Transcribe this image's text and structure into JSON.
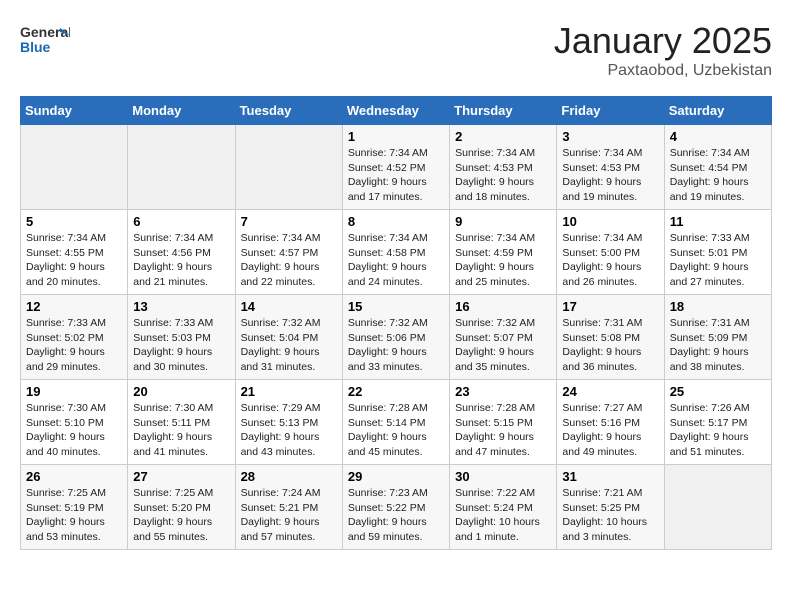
{
  "header": {
    "logo_line1": "General",
    "logo_line2": "Blue",
    "month": "January 2025",
    "location": "Paxtaobod, Uzbekistan"
  },
  "weekdays": [
    "Sunday",
    "Monday",
    "Tuesday",
    "Wednesday",
    "Thursday",
    "Friday",
    "Saturday"
  ],
  "weeks": [
    [
      {
        "day": "",
        "info": ""
      },
      {
        "day": "",
        "info": ""
      },
      {
        "day": "",
        "info": ""
      },
      {
        "day": "1",
        "info": "Sunrise: 7:34 AM\nSunset: 4:52 PM\nDaylight: 9 hours\nand 17 minutes."
      },
      {
        "day": "2",
        "info": "Sunrise: 7:34 AM\nSunset: 4:53 PM\nDaylight: 9 hours\nand 18 minutes."
      },
      {
        "day": "3",
        "info": "Sunrise: 7:34 AM\nSunset: 4:53 PM\nDaylight: 9 hours\nand 19 minutes."
      },
      {
        "day": "4",
        "info": "Sunrise: 7:34 AM\nSunset: 4:54 PM\nDaylight: 9 hours\nand 19 minutes."
      }
    ],
    [
      {
        "day": "5",
        "info": "Sunrise: 7:34 AM\nSunset: 4:55 PM\nDaylight: 9 hours\nand 20 minutes."
      },
      {
        "day": "6",
        "info": "Sunrise: 7:34 AM\nSunset: 4:56 PM\nDaylight: 9 hours\nand 21 minutes."
      },
      {
        "day": "7",
        "info": "Sunrise: 7:34 AM\nSunset: 4:57 PM\nDaylight: 9 hours\nand 22 minutes."
      },
      {
        "day": "8",
        "info": "Sunrise: 7:34 AM\nSunset: 4:58 PM\nDaylight: 9 hours\nand 24 minutes."
      },
      {
        "day": "9",
        "info": "Sunrise: 7:34 AM\nSunset: 4:59 PM\nDaylight: 9 hours\nand 25 minutes."
      },
      {
        "day": "10",
        "info": "Sunrise: 7:34 AM\nSunset: 5:00 PM\nDaylight: 9 hours\nand 26 minutes."
      },
      {
        "day": "11",
        "info": "Sunrise: 7:33 AM\nSunset: 5:01 PM\nDaylight: 9 hours\nand 27 minutes."
      }
    ],
    [
      {
        "day": "12",
        "info": "Sunrise: 7:33 AM\nSunset: 5:02 PM\nDaylight: 9 hours\nand 29 minutes."
      },
      {
        "day": "13",
        "info": "Sunrise: 7:33 AM\nSunset: 5:03 PM\nDaylight: 9 hours\nand 30 minutes."
      },
      {
        "day": "14",
        "info": "Sunrise: 7:32 AM\nSunset: 5:04 PM\nDaylight: 9 hours\nand 31 minutes."
      },
      {
        "day": "15",
        "info": "Sunrise: 7:32 AM\nSunset: 5:06 PM\nDaylight: 9 hours\nand 33 minutes."
      },
      {
        "day": "16",
        "info": "Sunrise: 7:32 AM\nSunset: 5:07 PM\nDaylight: 9 hours\nand 35 minutes."
      },
      {
        "day": "17",
        "info": "Sunrise: 7:31 AM\nSunset: 5:08 PM\nDaylight: 9 hours\nand 36 minutes."
      },
      {
        "day": "18",
        "info": "Sunrise: 7:31 AM\nSunset: 5:09 PM\nDaylight: 9 hours\nand 38 minutes."
      }
    ],
    [
      {
        "day": "19",
        "info": "Sunrise: 7:30 AM\nSunset: 5:10 PM\nDaylight: 9 hours\nand 40 minutes."
      },
      {
        "day": "20",
        "info": "Sunrise: 7:30 AM\nSunset: 5:11 PM\nDaylight: 9 hours\nand 41 minutes."
      },
      {
        "day": "21",
        "info": "Sunrise: 7:29 AM\nSunset: 5:13 PM\nDaylight: 9 hours\nand 43 minutes."
      },
      {
        "day": "22",
        "info": "Sunrise: 7:28 AM\nSunset: 5:14 PM\nDaylight: 9 hours\nand 45 minutes."
      },
      {
        "day": "23",
        "info": "Sunrise: 7:28 AM\nSunset: 5:15 PM\nDaylight: 9 hours\nand 47 minutes."
      },
      {
        "day": "24",
        "info": "Sunrise: 7:27 AM\nSunset: 5:16 PM\nDaylight: 9 hours\nand 49 minutes."
      },
      {
        "day": "25",
        "info": "Sunrise: 7:26 AM\nSunset: 5:17 PM\nDaylight: 9 hours\nand 51 minutes."
      }
    ],
    [
      {
        "day": "26",
        "info": "Sunrise: 7:25 AM\nSunset: 5:19 PM\nDaylight: 9 hours\nand 53 minutes."
      },
      {
        "day": "27",
        "info": "Sunrise: 7:25 AM\nSunset: 5:20 PM\nDaylight: 9 hours\nand 55 minutes."
      },
      {
        "day": "28",
        "info": "Sunrise: 7:24 AM\nSunset: 5:21 PM\nDaylight: 9 hours\nand 57 minutes."
      },
      {
        "day": "29",
        "info": "Sunrise: 7:23 AM\nSunset: 5:22 PM\nDaylight: 9 hours\nand 59 minutes."
      },
      {
        "day": "30",
        "info": "Sunrise: 7:22 AM\nSunset: 5:24 PM\nDaylight: 10 hours\nand 1 minute."
      },
      {
        "day": "31",
        "info": "Sunrise: 7:21 AM\nSunset: 5:25 PM\nDaylight: 10 hours\nand 3 minutes."
      },
      {
        "day": "",
        "info": ""
      }
    ]
  ]
}
